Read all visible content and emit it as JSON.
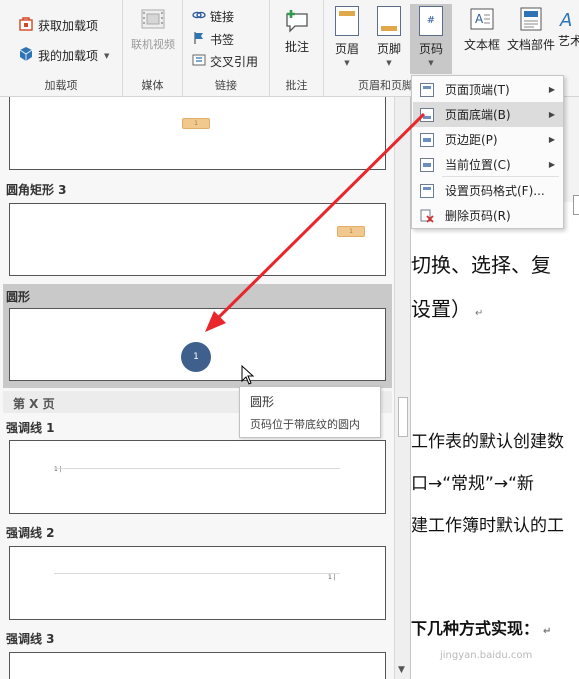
{
  "ribbon": {
    "addins": {
      "get_label": "获取加载项",
      "my_label": "我的加载项",
      "group_label": "加载项"
    },
    "media": {
      "online_video_label": "联机视频",
      "group_label": "媒体"
    },
    "links": {
      "link_label": "链接",
      "bookmark_label": "书签",
      "crossref_label": "交叉引用",
      "group_label": "链接"
    },
    "comments": {
      "comment_label": "批注",
      "group_label": "批注"
    },
    "header_footer": {
      "header_label": "页眉",
      "footer_label": "页脚",
      "page_number_label": "页码",
      "group_label": "页眉和页脚"
    },
    "text": {
      "textbox_label": "文本框",
      "docparts_label": "文档部件",
      "wordart_label": "艺术"
    }
  },
  "menu": {
    "items": [
      {
        "label": "页面顶端(T)",
        "icon": "page-top-icon",
        "has_submenu": true
      },
      {
        "label": "页面底端(B)",
        "icon": "page-bottom-icon",
        "has_submenu": true
      },
      {
        "label": "页边距(P)",
        "icon": "page-margin-icon",
        "has_submenu": true
      },
      {
        "label": "当前位置(C)",
        "icon": "current-position-icon",
        "has_submenu": true
      },
      {
        "label": "设置页码格式(F)...",
        "icon": "format-page-number-icon",
        "has_submenu": false
      },
      {
        "label": "删除页码(R)",
        "icon": "remove-page-number-icon",
        "has_submenu": false
      }
    ],
    "hovered_index": 1
  },
  "gallery": {
    "rounded_rect_title": "圆角矩形 3",
    "circle_title": "圆形",
    "circle_number": "1",
    "page_x_section": "第 X 页",
    "accent1_title": "强调线 1",
    "accent2_title": "强调线 2",
    "accent3_title": "强调线 3",
    "chip_text": "1",
    "accent_number": "1 |"
  },
  "tooltip": {
    "title": "圆形",
    "description": "页码位于带底纹的圆内"
  },
  "document": {
    "line1": "切换、选择、复",
    "line2": "设置）",
    "line3": "工作表的默认创建数",
    "line4": "口→“常规”→“新",
    "line5": "建工作簿时默认的工",
    "line6": "下几种方式实现：",
    "paragraph_mark": "↵"
  },
  "watermark": "jingyan.baidu.com",
  "colors": {
    "circle": "#3f5f8c",
    "arrow": "#e8262b",
    "chip": "#f1c98f"
  }
}
